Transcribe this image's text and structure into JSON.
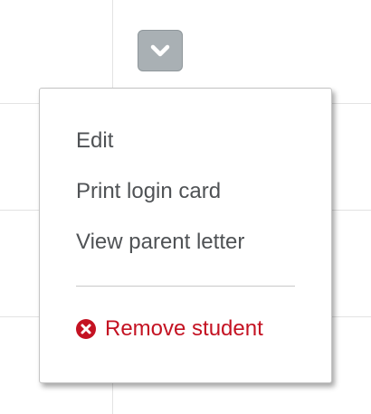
{
  "dropdown": {
    "toggle_icon": "chevron-down-icon",
    "toggle_color": "#a9b0b4",
    "items": [
      {
        "label": "Edit"
      },
      {
        "label": "Print login card"
      },
      {
        "label": "View parent letter"
      }
    ],
    "danger_item": {
      "label": "Remove student",
      "icon": "remove-circle-icon",
      "color": "#c41222"
    }
  }
}
